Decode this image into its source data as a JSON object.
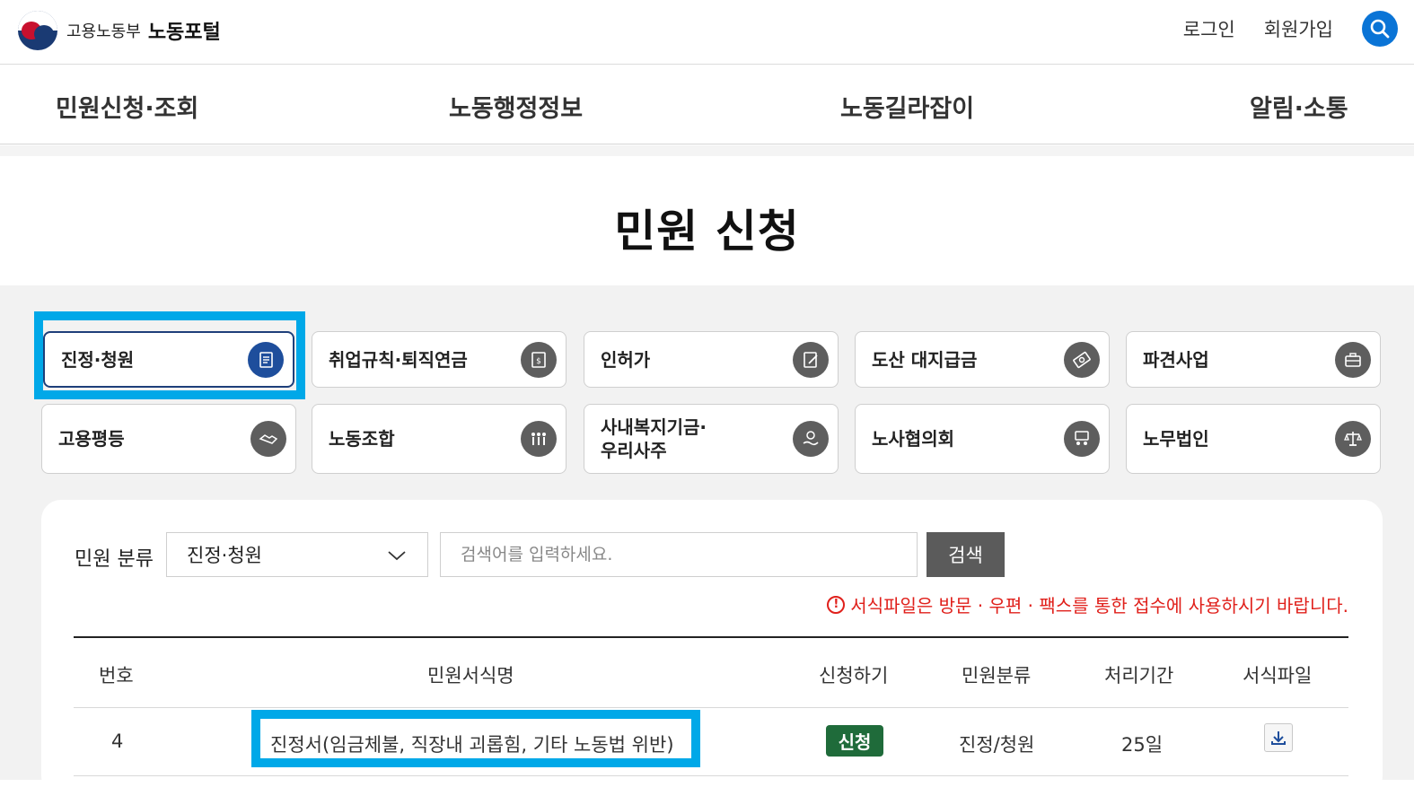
{
  "header": {
    "ministry": "고용노동부",
    "portal": "노동포털",
    "login": "로그인",
    "signup": "회원가입",
    "brand_color": "#0a74d6"
  },
  "gnb": [
    "민원신청·조회",
    "노동행정정보",
    "노동길라잡이",
    "알림·소통"
  ],
  "page_title": "민원 신청",
  "categories": [
    {
      "label": "진정·청원",
      "icon": "petition-icon",
      "active": true
    },
    {
      "label": "취업규칙·퇴직연금",
      "icon": "document-money-icon"
    },
    {
      "label": "인허가",
      "icon": "permit-icon"
    },
    {
      "label": "도산 대지급금",
      "icon": "money-icon"
    },
    {
      "label": "파견사업",
      "icon": "briefcase-icon"
    },
    {
      "label": "고용평등",
      "icon": "handshake-icon"
    },
    {
      "label": "노동조합",
      "icon": "union-icon"
    },
    {
      "label": "사내복지기금·\n우리사주",
      "icon": "welfare-fund-icon"
    },
    {
      "label": "노사협의회",
      "icon": "council-icon"
    },
    {
      "label": "노무법인",
      "icon": "scales-icon"
    }
  ],
  "filter": {
    "label": "민원 분류",
    "selected": "진정·청원",
    "search_placeholder": "검색어를 입력하세요.",
    "search_button": "검색",
    "notice": "서식파일은 방문 · 우편 · 팩스를 통한 접수에 사용하시기 바랍니다.",
    "notice_color": "#e0201b"
  },
  "table": {
    "headers": [
      "번호",
      "민원서식명",
      "신청하기",
      "민원분류",
      "처리기간",
      "서식파일"
    ],
    "rows": [
      {
        "no": "4",
        "name": "진정서(임금체불, 직장내 괴롭힘, 기타 노동법 위반)",
        "apply": "신청",
        "category": "진정/청원",
        "period": "25일",
        "file_icon": "download-icon"
      }
    ]
  }
}
